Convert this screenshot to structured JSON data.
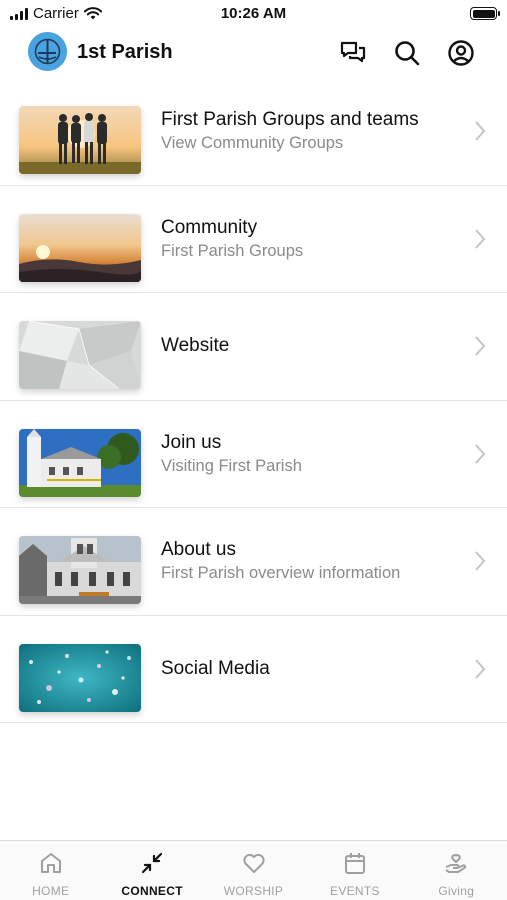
{
  "status_bar": {
    "carrier": "Carrier",
    "time": "10:26 AM"
  },
  "header": {
    "title": "1st Parish"
  },
  "list": {
    "items": [
      {
        "title": "First Parish Groups and teams",
        "subtitle": "View Community Groups",
        "image": "group-silhouettes-sunset"
      },
      {
        "title": "Community",
        "subtitle": "First Parish Groups",
        "image": "sunrise-over-clouds"
      },
      {
        "title": "Website",
        "subtitle": "",
        "image": "paper-shapes"
      },
      {
        "title": "Join us",
        "subtitle": "Visiting First Parish",
        "image": "church-exterior"
      },
      {
        "title": "About us",
        "subtitle": "First Parish overview information",
        "image": "church-building"
      },
      {
        "title": "Social Media",
        "subtitle": "",
        "image": "teal-bokeh"
      }
    ]
  },
  "tabs": [
    {
      "label": "HOME",
      "icon": "home-icon",
      "active": false
    },
    {
      "label": "CONNECT",
      "icon": "connect-icon",
      "active": true
    },
    {
      "label": "WORSHIP",
      "icon": "heart-icon",
      "active": false
    },
    {
      "label": "EVENTS",
      "icon": "calendar-icon",
      "active": false
    },
    {
      "label": "Giving",
      "icon": "giving-icon",
      "active": false
    }
  ],
  "colors": {
    "accent": "#4aa3df",
    "inactive": "#a0a0a0",
    "subtitle": "#8a8a8a"
  }
}
